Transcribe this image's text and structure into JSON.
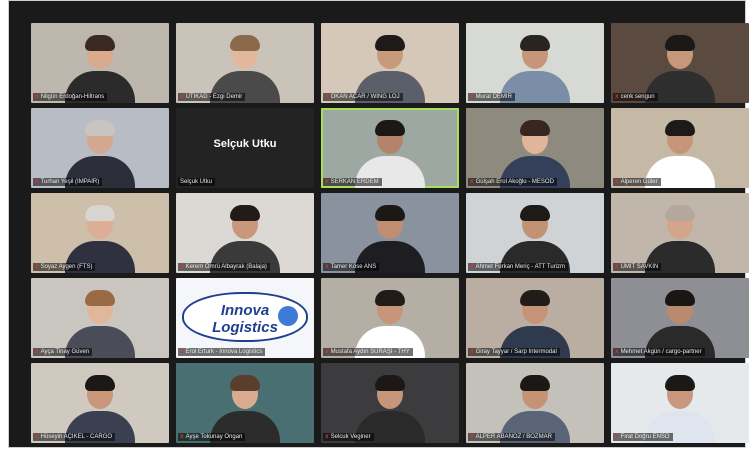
{
  "participants": [
    {
      "name": "Nilgün Erdoğan-Hiltrans",
      "bg": "#bdb7ad",
      "skin": "#d9aa8c",
      "hair": "#3a2a22",
      "shirt": "#2b2b2b"
    },
    {
      "name": "UTIKAD - Ezgi Demir",
      "bg": "#c9c3b9",
      "skin": "#e2b89c",
      "hair": "#8a6a4a",
      "shirt": "#4a4a4a"
    },
    {
      "name": "OKAN ACAR / WING LOJ",
      "bg": "#d6c8b8",
      "skin": "#c99a7a",
      "hair": "#1f1a18",
      "shirt": "#5a5f6a"
    },
    {
      "name": "Murat DEMİR",
      "bg": "#d7d9d4",
      "skin": "#c7967a",
      "hair": "#2a2420",
      "shirt": "#7b8ea8"
    },
    {
      "name": "cenk sengun",
      "bg": "#5a4a40",
      "skin": "#c6977a",
      "hair": "#1c1816",
      "shirt": "#2e2e2e"
    },
    {
      "name": "Turhan Yeşil (IMPAIR)",
      "bg": "#b8bcc4",
      "skin": "#d4a88e",
      "hair": "#c8c4c0",
      "shirt": "#2c2f3a"
    },
    {
      "name": "Selçuk Utku",
      "bg": "#232323",
      "skin": "",
      "hair": "",
      "shirt": "",
      "big": "Selçuk Utku"
    },
    {
      "name": "SERKAN ERDEM",
      "bg": "#9ea8a2",
      "skin": "#b4846a",
      "hair": "#1c1816",
      "shirt": "#e8e8e8",
      "active": true
    },
    {
      "name": "Gülşah Erol Akoğlu - MESOD",
      "bg": "#8f8a7e",
      "skin": "#e0b59a",
      "hair": "#3a2620",
      "shirt": "#34405a"
    },
    {
      "name": "Alperen Güler",
      "bg": "#c5b9a6",
      "skin": "#c7957a",
      "hair": "#1e1a18",
      "shirt": "#ffffff"
    },
    {
      "name": "Soyaz Aygen (FTS)",
      "bg": "#cdbfa9",
      "skin": "#dcae96",
      "hair": "#d8d4cf",
      "shirt": "#2f3140"
    },
    {
      "name": "Kerem Ömrü Albayrak (Balaja)",
      "bg": "#dcd8d3",
      "skin": "#c9977b",
      "hair": "#221c18",
      "shirt": "#3a3a3a"
    },
    {
      "name": "Tamer Köse ANS",
      "bg": "#8a92a0",
      "skin": "#c08d70",
      "hair": "#1c1816",
      "shirt": "#1e1e22"
    },
    {
      "name": "Ahmet Furkan Meriç - ATT Turizm",
      "bg": "#cfd3d6",
      "skin": "#c29274",
      "hair": "#1e1a18",
      "shirt": "#2a2a2a"
    },
    {
      "name": "ÜMİT SAVKIN",
      "bg": "#c0b6aa",
      "skin": "#d4a58a",
      "hair": "#b4a89c",
      "shirt": "#2b2b2b"
    },
    {
      "name": "Ayça Tinay Güven",
      "bg": "#c9c6c0",
      "skin": "#e0b79c",
      "hair": "#9a6a44",
      "shirt": "#4a4c58"
    },
    {
      "name": "Erol Erturk - Innova Logistics",
      "bg": "#f4f6fa",
      "skin": "",
      "hair": "",
      "shirt": "",
      "logo": true
    },
    {
      "name": "Mustafa Aydın SÜRAŞI - THY",
      "bg": "#b5aea4",
      "skin": "#c6957a",
      "hair": "#221c18",
      "shirt": "#ffffff"
    },
    {
      "name": "Giray Tayyar / Sarp Intermodal",
      "bg": "#b9aea1",
      "skin": "#c79378",
      "hair": "#221c18",
      "shirt": "#2f3a4e"
    },
    {
      "name": "Mehmet Akgün / cargo-partner",
      "bg": "#8d8f94",
      "skin": "#b98a6e",
      "hair": "#1a1614",
      "shirt": "#2a2a2a"
    },
    {
      "name": "Hüseyin AÇIKEL - CARGO",
      "bg": "#cfc9c0",
      "skin": "#c9967a",
      "hair": "#1c1816",
      "shirt": "#3a4050"
    },
    {
      "name": "Ayşe Tokunay Ongan",
      "bg": "#4a6f72",
      "skin": "#d9ac90",
      "hair": "#5a3e2c",
      "shirt": "#2c2c2c"
    },
    {
      "name": "Selcuk Veginer",
      "bg": "#3c3c3e",
      "skin": "#c6967a",
      "hair": "#1c1816",
      "shirt": "#2a2a2a"
    },
    {
      "name": "ALPER ABANOZ / BOZMAR",
      "bg": "#c4c0ba",
      "skin": "#c69276",
      "hair": "#1c1816",
      "shirt": "#5a6478"
    },
    {
      "name": "Fırat Doğru ENSO",
      "bg": "#e6e9ec",
      "skin": "#c9987c",
      "hair": "#1c1816",
      "shirt": "#dfe5ee"
    }
  ],
  "logo": {
    "line1": "Innova",
    "line2": "Logistics"
  },
  "mic_glyph": "ⅹ"
}
